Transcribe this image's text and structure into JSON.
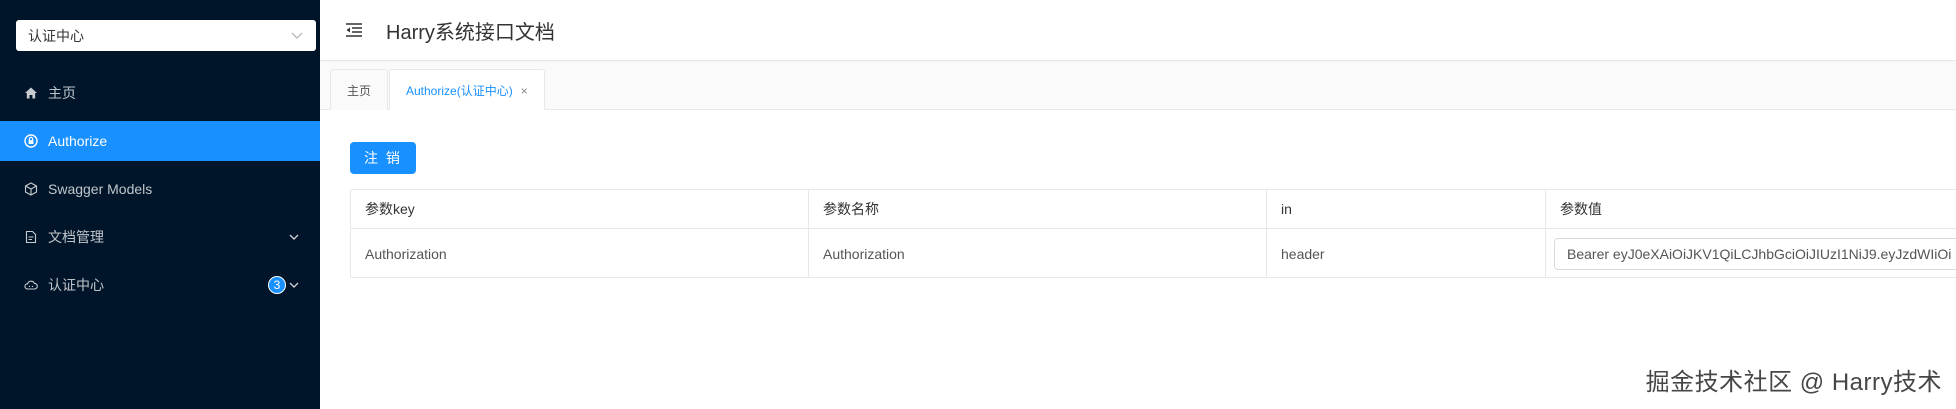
{
  "sidebar": {
    "group_select": {
      "value": "认证中心"
    },
    "items": [
      {
        "label": "主页",
        "icon": "home-icon"
      },
      {
        "label": "Authorize",
        "icon": "lock-icon",
        "active": true
      },
      {
        "label": "Swagger Models",
        "icon": "cube-icon"
      },
      {
        "label": "文档管理",
        "icon": "doc-manage-icon",
        "expandable": true
      },
      {
        "label": "认证中心",
        "icon": "cloud-icon",
        "expandable": true,
        "badge": "3"
      }
    ]
  },
  "header": {
    "title": "Harry系统接口文档"
  },
  "tabs": [
    {
      "label": "主页"
    },
    {
      "label": "Authorize(认证中心)",
      "active": true,
      "close": "×"
    }
  ],
  "auth": {
    "logout_label": "注 销",
    "table": {
      "headers": [
        "参数key",
        "参数名称",
        "in",
        "参数值"
      ],
      "rows": [
        [
          "Authorization",
          "Authorization",
          "header",
          "Bearer eyJ0eXAiOiJKV1QiLCJhbGciOiJIUzI1NiJ9.eyJzdWIiOi"
        ]
      ]
    }
  },
  "watermark": "掘金技术社区 @ Harry技术",
  "colors": {
    "sidebar_bg": "#001529",
    "accent": "#1890ff"
  }
}
